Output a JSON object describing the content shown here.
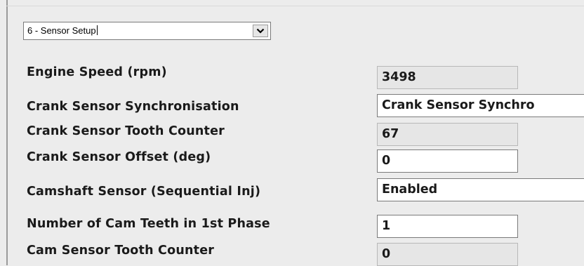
{
  "dropdown": {
    "selected": "6 - Sensor Setup",
    "button_icon": "chevron-down-icon"
  },
  "rows": [
    {
      "label": "Engine Speed (rpm)",
      "value": "3498"
    },
    {
      "label": "Crank Sensor Synchronisation",
      "value": "Crank Sensor Synchro"
    },
    {
      "label": "Crank Sensor Tooth Counter",
      "value": "67"
    },
    {
      "label": "Crank Sensor Offset (deg)",
      "value": "0"
    },
    {
      "label": "Camshaft Sensor (Sequential Inj)",
      "value": "Enabled"
    },
    {
      "label": "Number of Cam Teeth in 1st Phase",
      "value": "1"
    },
    {
      "label": "Cam Sensor Tooth Counter",
      "value": "0"
    }
  ]
}
